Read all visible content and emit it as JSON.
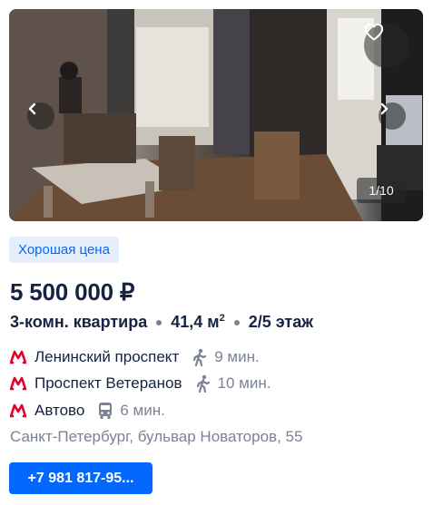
{
  "gallery": {
    "counter": "1/10",
    "favorite_icon": "heart-outline-icon",
    "prev_icon": "chevron-left-icon",
    "next_icon": "chevron-right-icon"
  },
  "badge": "Хорошая цена",
  "price": "5 500 000 ₽",
  "params": {
    "rooms": "3-комн. квартира",
    "area_value": "41,4 м",
    "area_sup": "2",
    "floor": "2/5 этаж"
  },
  "metro": [
    {
      "station": "Ленинский проспект",
      "mode": "walk",
      "icon": "walking-person-icon",
      "time": "9 мин."
    },
    {
      "station": "Проспект Ветеранов",
      "mode": "walk",
      "icon": "walking-person-icon",
      "time": "10 мин."
    },
    {
      "station": "Автово",
      "mode": "transport",
      "icon": "bus-icon",
      "time": "6 мин."
    }
  ],
  "colors": {
    "metro_line": "#e4002b",
    "accent": "#0468ff",
    "badge_bg": "#e5eefc",
    "text_primary": "#152242",
    "text_secondary": "#7a8294"
  },
  "address": "Санкт-Петербург, бульвар Новаторов, 55",
  "phone_button": "+7 981 817-95..."
}
